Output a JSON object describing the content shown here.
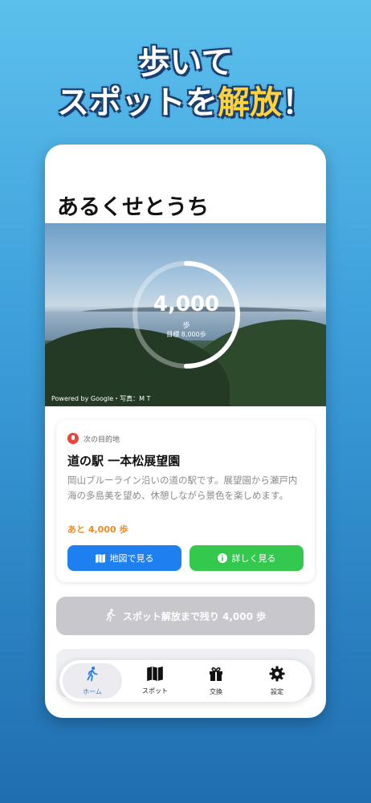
{
  "headline": {
    "line1": "歩いて",
    "line2_prefix": "スポットを",
    "line2_highlight": "解放",
    "line2_suffix": "！"
  },
  "app": {
    "title": "あるくせとうち"
  },
  "steps": {
    "count": "4,000",
    "unit": "歩",
    "goal": "目標 8,000歩",
    "progress": 0.5
  },
  "hero": {
    "credit": "Powered by Google・写真：M T"
  },
  "destination": {
    "label": "次の目的地",
    "name": "道の駅 一本松展望園",
    "description": "岡山ブルーライン沿いの道の駅です。展望園から瀬戸内海の多島美を望め、休憩しながら景色を楽しめます。",
    "remaining": "あと 4,000 歩",
    "map_button": "地図で見る",
    "info_button": "詳しく見る"
  },
  "unlock": {
    "label": "スポット解放まで残り 4,000 歩"
  },
  "tabs": [
    {
      "label": "ホーム",
      "icon": "walk-icon"
    },
    {
      "label": "スポット",
      "icon": "map-icon"
    },
    {
      "label": "交換",
      "icon": "gift-icon"
    },
    {
      "label": "設定",
      "icon": "gear-icon"
    }
  ],
  "colors": {
    "primary_blue": "#1e7ff0",
    "green": "#35c84e",
    "orange": "#f08a24",
    "highlight_yellow": "#ffd23c"
  }
}
